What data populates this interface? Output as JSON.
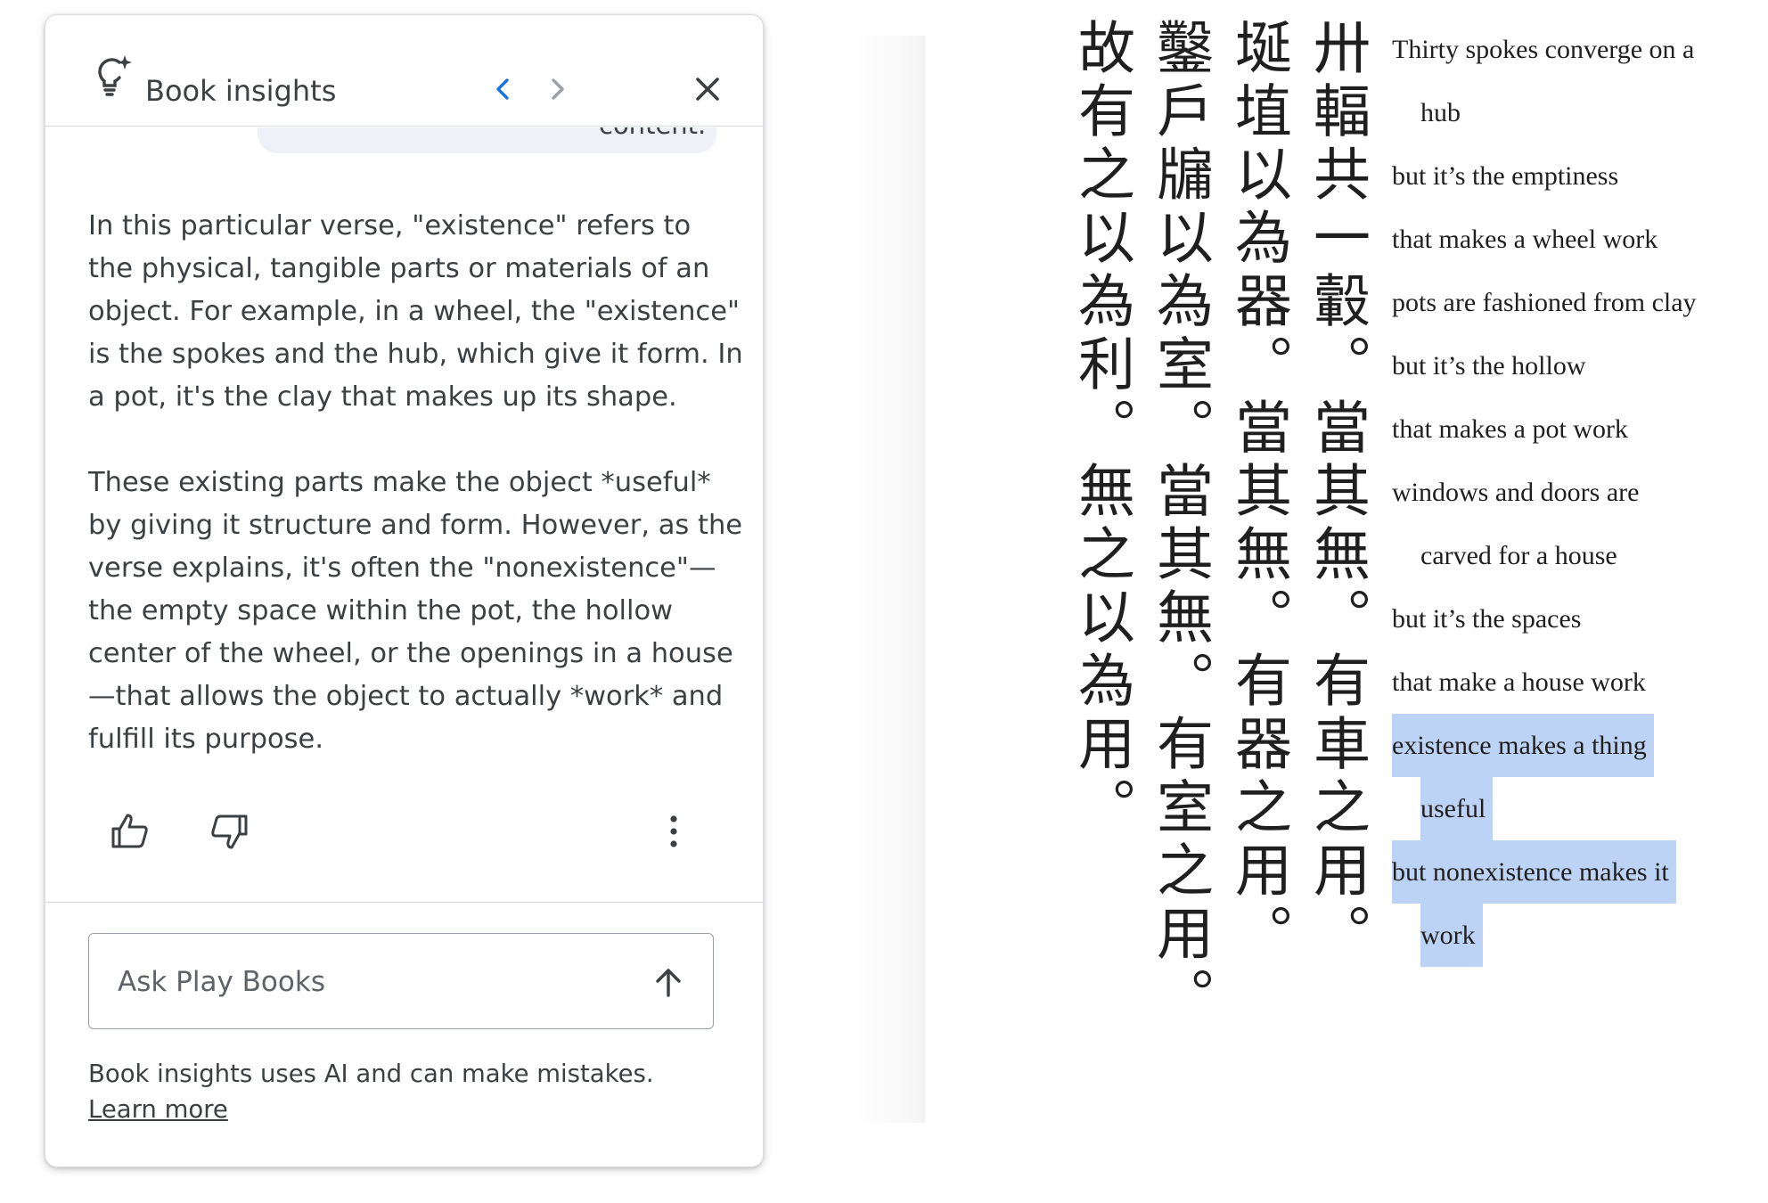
{
  "panel": {
    "title": "Book insights",
    "previous_message_fragment": "content.",
    "answer_paragraphs": [
      "In this particular verse, \"existence\" refers to the physical, tangible parts or materials of an object. For example, in a wheel, the \"existence\" is the spokes and the hub, which give it form. In a pot, it's the clay that makes up its shape.",
      "These existing parts make the object *useful* by giving it structure and form. However, as the verse explains, it's often the \"nonexistence\"—the empty space within the pot, the hollow center of the wheel, or the openings in a house—that allows the object to actually *work* and fulfill its purpose."
    ],
    "ask_placeholder": "Ask Play Books",
    "disclaimer": "Book insights uses AI and can make mistakes.",
    "learn_more": "Learn more",
    "accent_color": "#1a73e8"
  },
  "book": {
    "chinese_columns": [
      "卅輻共一轂。當其無。有車之用。",
      "埏埴以為器。當其無。有器之用。",
      "鑿戶牖以為室。當其無。有室之用。",
      "故有之以為利。無之以為用。"
    ],
    "verse_lines": [
      {
        "text": "Thirty spokes converge on a",
        "cont": false,
        "highlighted": false
      },
      {
        "text": "hub",
        "cont": true,
        "highlighted": false
      },
      {
        "text": "but it’s the emptiness",
        "cont": false,
        "highlighted": false
      },
      {
        "text": "that makes a wheel work",
        "cont": false,
        "highlighted": false
      },
      {
        "text": "pots are fashioned from clay",
        "cont": false,
        "highlighted": false
      },
      {
        "text": "but it’s the hollow",
        "cont": false,
        "highlighted": false
      },
      {
        "text": "that makes a pot work",
        "cont": false,
        "highlighted": false
      },
      {
        "text": "windows and doors are",
        "cont": false,
        "highlighted": false
      },
      {
        "text": "carved for a house",
        "cont": true,
        "highlighted": false
      },
      {
        "text": "but it’s the spaces",
        "cont": false,
        "highlighted": false
      },
      {
        "text": "that make a house work",
        "cont": false,
        "highlighted": false
      },
      {
        "text": "existence makes a thing",
        "cont": false,
        "highlighted": true
      },
      {
        "text": "useful",
        "cont": true,
        "highlighted": true
      },
      {
        "text": "but nonexistence makes it",
        "cont": false,
        "highlighted": true
      },
      {
        "text": "work",
        "cont": true,
        "highlighted": true
      }
    ],
    "highlight_color": "#bcd3f5"
  }
}
